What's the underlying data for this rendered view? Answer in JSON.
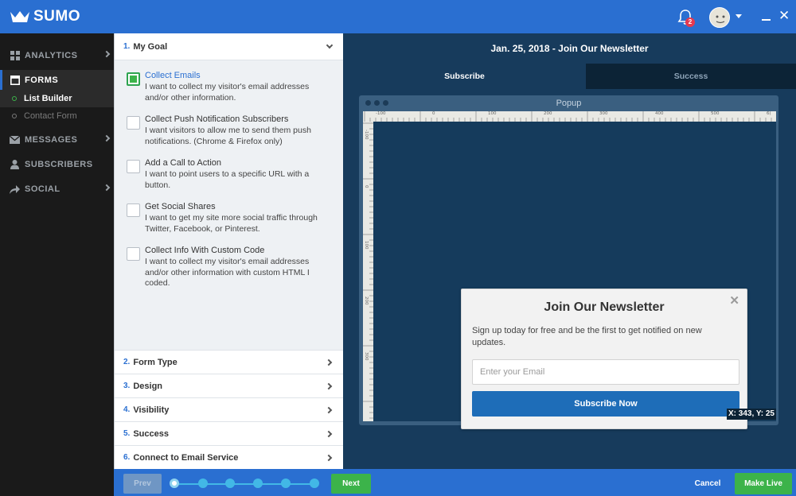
{
  "app": {
    "logo_text": "SUMO"
  },
  "topbar": {
    "notifications_count": "2",
    "brand_color": "#2a6fd1"
  },
  "sidebar": {
    "items": [
      {
        "label": "ANALYTICS",
        "icon": "grid-icon"
      },
      {
        "label": "FORMS",
        "icon": "form-icon"
      },
      {
        "label": "MESSAGES",
        "icon": "envelope-icon"
      },
      {
        "label": "SUBSCRIBERS",
        "icon": "person-icon"
      },
      {
        "label": "SOCIAL",
        "icon": "share-icon"
      }
    ],
    "subitems": [
      {
        "label": "List Builder"
      },
      {
        "label": "Contact Form"
      }
    ]
  },
  "panel": {
    "goal": {
      "num": "1.",
      "title": "My Goal"
    },
    "options": [
      {
        "title": "Collect Emails",
        "desc": "I want to collect my visitor's email addresses and/or other information.",
        "checked": true
      },
      {
        "title": "Collect Push Notification Subscribers",
        "desc": "I want visitors to allow me to send them push notifications. (Chrome & Firefox only)",
        "checked": false
      },
      {
        "title": "Add a Call to Action",
        "desc": "I want to point users to a specific URL with a button.",
        "checked": false
      },
      {
        "title": "Get Social Shares",
        "desc": "I want to get my site more social traffic through Twitter, Facebook, or Pinterest.",
        "checked": false
      },
      {
        "title": "Collect Info With Custom Code",
        "desc": "I want to collect my visitor's email addresses and/or other information with custom HTML I coded.",
        "checked": false
      }
    ],
    "steps": [
      {
        "num": "2.",
        "title": "Form Type"
      },
      {
        "num": "3.",
        "title": "Design"
      },
      {
        "num": "4.",
        "title": "Visibility"
      },
      {
        "num": "5.",
        "title": "Success"
      },
      {
        "num": "6.",
        "title": "Connect to Email Service"
      }
    ]
  },
  "preview": {
    "title": "Jan. 25, 2018 - Join Our Newsletter",
    "tabs": [
      {
        "label": "Subscribe",
        "active": true
      },
      {
        "label": "Success",
        "active": false
      }
    ],
    "window_title": "Popup",
    "ruler_top": [
      "-100",
      "0",
      "100",
      "200",
      "300",
      "400",
      "500",
      "6("
    ],
    "ruler_left": [
      "-100",
      "0",
      "100",
      "200",
      "300"
    ],
    "coords": "X: 343, Y: 25",
    "popup": {
      "title": "Join Our Newsletter",
      "desc": "Sign up today for free and be the first to get notified on new updates.",
      "input_placeholder": "Enter your Email",
      "button": "Subscribe Now"
    }
  },
  "bottombar": {
    "prev": "Prev",
    "next": "Next",
    "cancel": "Cancel",
    "make_live": "Make Live",
    "progress_steps": 6,
    "current_step": 1
  }
}
